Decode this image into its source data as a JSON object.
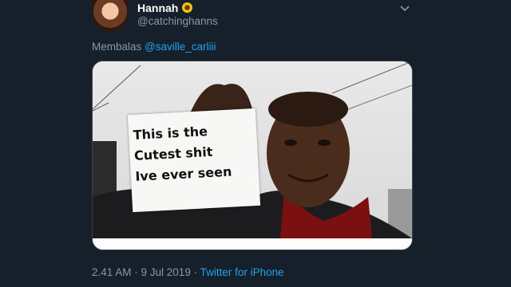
{
  "tweet": {
    "author_name": "Hannah",
    "author_handle": "@catchinghanns",
    "reply_prefix": "Membalas",
    "reply_mention": "@saville_carliii",
    "image_sign_lines": [
      "This is the",
      "Cutest shit",
      "Ive ever seen"
    ],
    "timestamp": "2.41 AM · 9 Jul 2019 ·",
    "source": "Twitter for iPhone"
  },
  "icons": {
    "avatar": "avatar",
    "name_emoji": "sunflower-icon",
    "menu": "chevron-down-icon"
  },
  "colors": {
    "background": "#15202b",
    "muted": "#8899a6",
    "link": "#1da1f2"
  }
}
